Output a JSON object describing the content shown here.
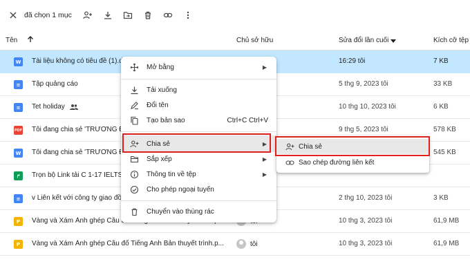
{
  "toolbar": {
    "selection_text": "đã chọn 1 mục"
  },
  "header": {
    "name_col": "Tên",
    "owner_col": "Chủ sở hữu",
    "modified_col": "Sửa đổi lần cuối",
    "size_col": "Kích cỡ tệp"
  },
  "rows": [
    {
      "name": "Tài liệu không có tiêu đề (1).docx",
      "icon": "word-icon",
      "color": "#4285f4",
      "glyph": "W",
      "owner": "",
      "modified": "16:29 tôi",
      "size": "7 KB"
    },
    {
      "name": "Tập quảng cáo",
      "icon": "docs-icon",
      "color": "#4285f4",
      "glyph": "≡",
      "owner": "",
      "modified": "5 thg 9, 2023 tôi",
      "size": "33 KB"
    },
    {
      "name": "Tet holiday",
      "icon": "docs-icon",
      "color": "#4285f4",
      "glyph": "≡",
      "owner": "",
      "modified": "10 thg 10, 2023 tôi",
      "size": "6 KB"
    },
    {
      "name": "Tôi đang chia sẻ 'TRƯỜNG ĐẠ",
      "icon": "pdf-icon",
      "color": "#ea4335",
      "glyph": "PDF",
      "owner": "",
      "modified": "9 thg 5, 2023 tôi",
      "size": "578 KB"
    },
    {
      "name": "Tôi đang chia sẻ 'TRƯỜNG ĐẠ",
      "icon": "word-icon",
      "color": "#4285f4",
      "glyph": "W",
      "owner": "",
      "modified": "",
      "size": "545 KB"
    },
    {
      "name": "Trọn bộ Link tải C 1-17 IELTS P",
      "icon": "shortcut-icon",
      "color": "#0f9d58",
      "glyph": "↱",
      "owner": "",
      "modified": "",
      "size": ""
    },
    {
      "name": "v Liên kết với công ty giao đồ",
      "icon": "docs-icon",
      "color": "#4285f4",
      "glyph": "≡",
      "owner": "",
      "modified": "2 thg 10, 2023 tôi",
      "size": "3 KB"
    },
    {
      "name": "Vàng và Xám Ảnh ghép Câu đố Tiếng Anh Bản thuyết trình.p...",
      "icon": "slides-icon",
      "color": "#f4b400",
      "glyph": "P",
      "owner": "tôi",
      "modified": "10 thg 3, 2023 tôi",
      "size": "61,9 MB"
    },
    {
      "name": "Vàng và Xám Ảnh ghép Câu đố Tiếng Anh Bản thuyết trình.p...",
      "icon": "slides-icon",
      "color": "#f4b400",
      "glyph": "P",
      "owner": "tôi",
      "modified": "10 thg 3, 2023 tôi",
      "size": "61,9 MB"
    }
  ],
  "context_menu": {
    "open_with": "Mở bằng",
    "download": "Tải xuống",
    "rename": "Đổi tên",
    "make_copy": "Tạo bản sao",
    "make_copy_shortcut": "Ctrl+C Ctrl+V",
    "share": "Chia sẻ",
    "organize": "Sắp xếp",
    "file_info": "Thông tin về tệp",
    "offline": "Cho phép ngoại tuyến",
    "trash": "Chuyển vào thùng rác"
  },
  "share_submenu": {
    "share": "Chia sẻ",
    "copy_link": "Sao chép đường liên kết"
  },
  "colors": {
    "selected_row": "#c2e7ff",
    "highlight_box": "#e0201b",
    "menu_hover": "#e8e8e8"
  }
}
